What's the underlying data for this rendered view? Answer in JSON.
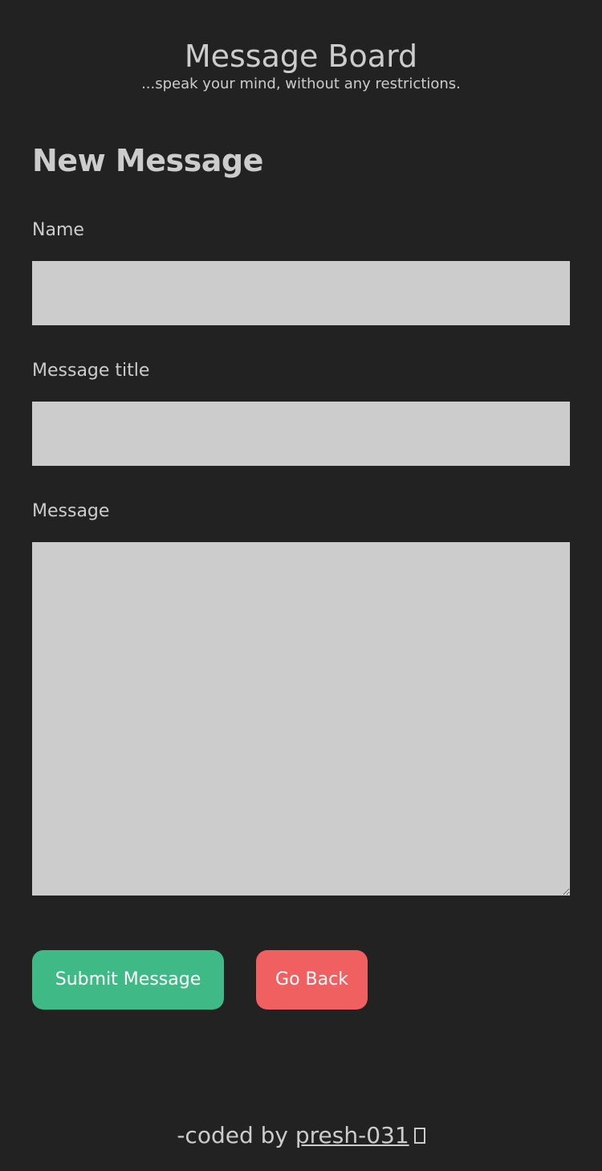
{
  "header": {
    "title": "Message Board",
    "tagline": "...speak your mind, without any restrictions."
  },
  "form": {
    "heading": "New Message",
    "name_label": "Name",
    "name_value": "",
    "title_label": "Message title",
    "title_value": "",
    "message_label": "Message",
    "message_value": "",
    "submit_label": "Submit Message",
    "back_label": "Go Back"
  },
  "footer": {
    "prefix": "-coded by ",
    "author_link": "presh-031",
    "emoji_icon": "missing-glyph-icon"
  },
  "colors": {
    "background": "#222222",
    "text": "#cccccc",
    "input_bg": "#cccccc",
    "submit": "#3fba87",
    "back": "#f06060"
  }
}
